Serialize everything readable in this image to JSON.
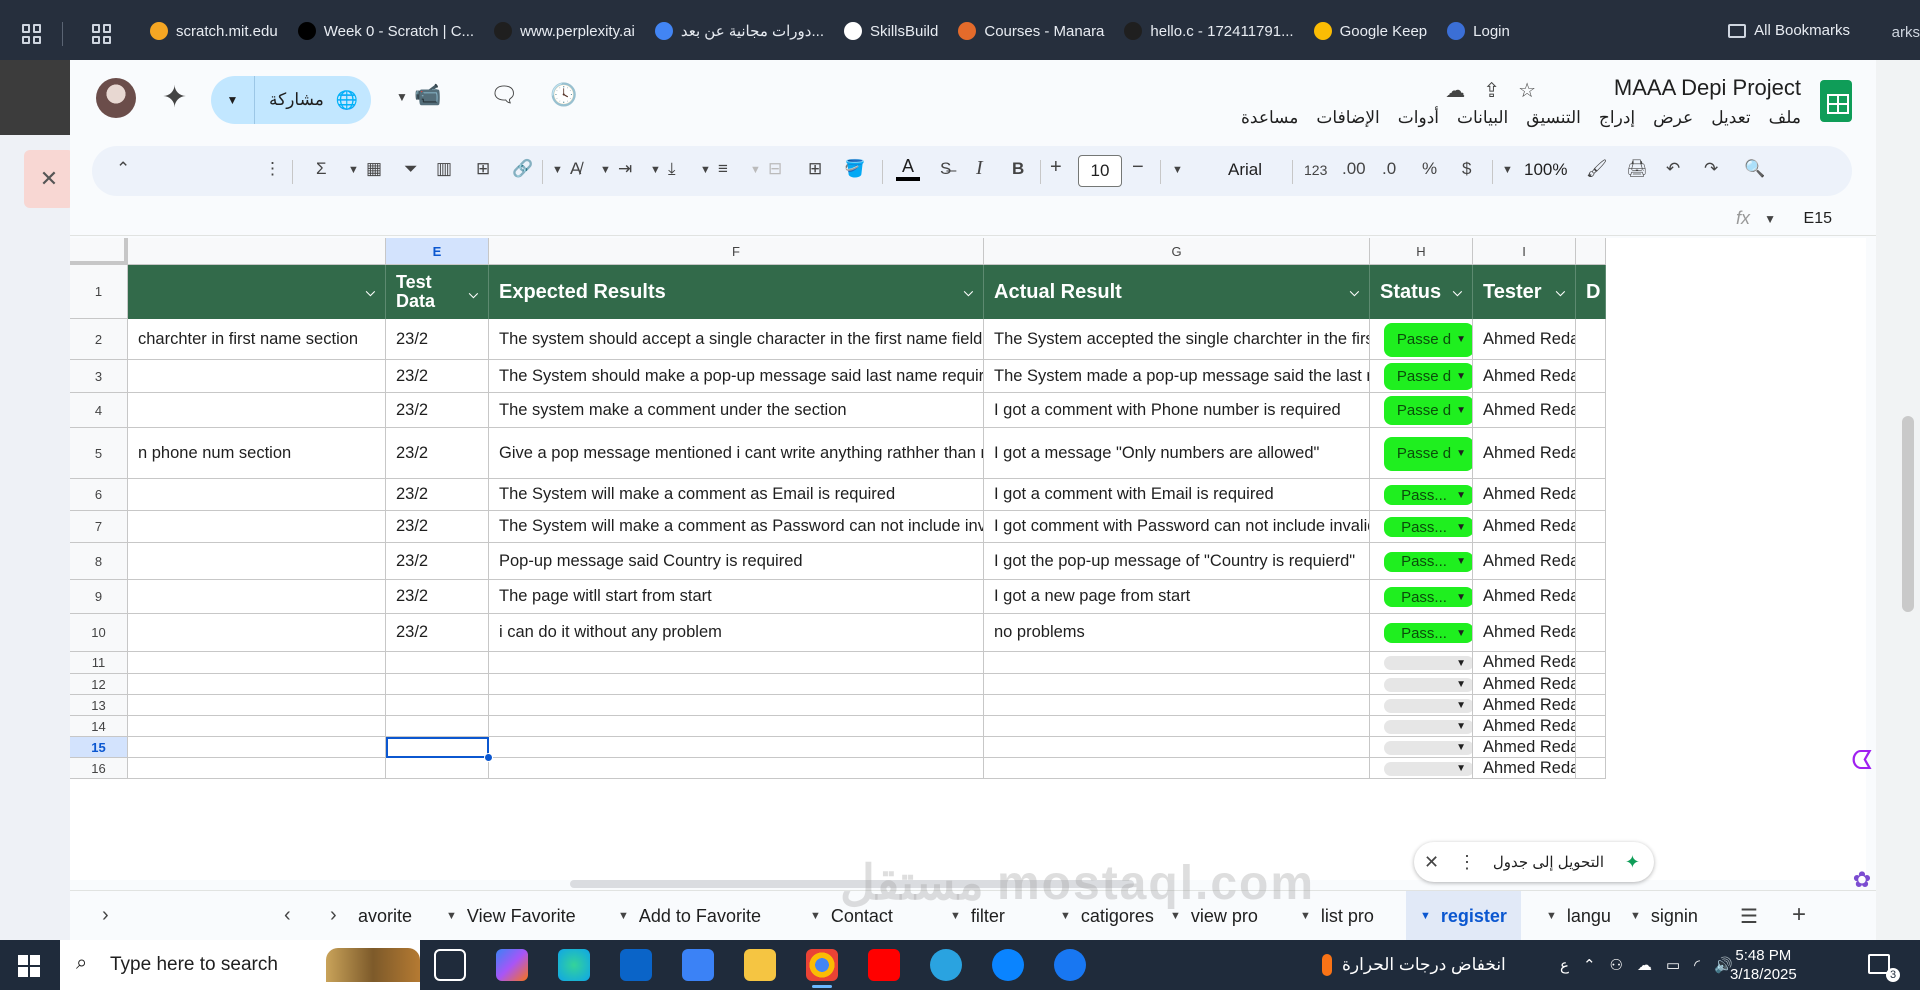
{
  "browser": {
    "bookmarks": [
      {
        "label": "scratch.mit.edu",
        "color": "#f5a623"
      },
      {
        "label": "Week 0 - Scratch | C...",
        "color": "#000000"
      },
      {
        "label": "www.perplexity.ai",
        "color": "#1f1f1f"
      },
      {
        "label": "دورات مجانية عن بعد...",
        "color": "#4285f4"
      },
      {
        "label": "SkillsBuild",
        "color": "#ffffff"
      },
      {
        "label": "Courses - Manara",
        "color": "#e46b2b"
      },
      {
        "label": "hello.c - 172411791...",
        "color": "#1f1f1f"
      },
      {
        "label": "Google Keep",
        "color": "#fbbc04"
      },
      {
        "label": "Login",
        "color": "#3b6fd6"
      }
    ],
    "all_bookmarks": "All Bookmarks",
    "more": "arks"
  },
  "sheets": {
    "title": "MAAA Depi Project",
    "menus": [
      "ملف",
      "تعديل",
      "عرض",
      "إدراج",
      "التنسيق",
      "البيانات",
      "أدوات",
      "الإضافات",
      "مساعدة"
    ],
    "share_label": "مشاركة",
    "toolbar": {
      "zoom": "100%",
      "font": "Arial",
      "font_size": "10",
      "currency": "$",
      "percent": "%",
      "number_format": "123"
    },
    "name_box": "E15",
    "fx": "fx",
    "columns": [
      {
        "letter": "",
        "header": ""
      },
      {
        "letter": "E",
        "header": "Test Data"
      },
      {
        "letter": "F",
        "header": "Expected Results"
      },
      {
        "letter": "G",
        "header": "Actual Result"
      },
      {
        "letter": "H",
        "header": "Status"
      },
      {
        "letter": "I",
        "header": "Tester"
      },
      {
        "letter": "",
        "header": "D"
      }
    ],
    "rows": [
      {
        "n": "2",
        "d": "charchter in first name section",
        "e": "23/2",
        "f": "The system should accept a single character in the first name field",
        "g": "The System accepted the single charchter in the first name",
        "status": "Passe d",
        "tester": "Ahmed Reda"
      },
      {
        "n": "3",
        "d": "",
        "e": "23/2",
        "f": "The System should make a pop-up message said last name required",
        "g": "The System made a pop-up message said the last name is req",
        "status": "Passe d",
        "tester": "Ahmed Reda"
      },
      {
        "n": "4",
        "d": "",
        "e": "23/2",
        "f": "The system make a comment under the section",
        "g": "I got a comment with Phone number is required",
        "status": "Passe d",
        "tester": "Ahmed Reda"
      },
      {
        "n": "5",
        "d": "n phone num section",
        "e": "23/2",
        "f": "Give a pop message mentioned i cant write anything rathher than numbers",
        "g": "I got a message \"Only numbers are allowed\"",
        "status": "Passe d",
        "tester": "Ahmed Reda"
      },
      {
        "n": "6",
        "d": "",
        "e": "23/2",
        "f": "The System will make a comment as Email is required",
        "g": "I got a comment with Email is required",
        "status": "Pass...",
        "tester": "Ahmed Reda"
      },
      {
        "n": "7",
        "d": "",
        "e": "23/2",
        "f": "The System will make a comment as Password can not include invalid characters",
        "g": "I got comment with Password can not include invalid character",
        "status": "Pass...",
        "tester": "Ahmed Reda"
      },
      {
        "n": "8",
        "d": "",
        "e": "23/2",
        "f": "Pop-up message said Country is required",
        "g": "I got the pop-up message of \"Country is requierd\"",
        "status": "Pass...",
        "tester": "Ahmed Reda"
      },
      {
        "n": "9",
        "d": "",
        "e": "23/2",
        "f": "The page witll start from start",
        "g": "I got a new page from start",
        "status": "Pass...",
        "tester": "Ahmed Reda"
      },
      {
        "n": "10",
        "d": "",
        "e": "23/2",
        "f": "i can do it without any problem",
        "g": "no problems",
        "status": "Pass...",
        "tester": "Ahmed Reda"
      },
      {
        "n": "11",
        "tester": "Ahmed Reda"
      },
      {
        "n": "12",
        "tester": "Ahmed Reda"
      },
      {
        "n": "13",
        "tester": "Ahmed Reda"
      },
      {
        "n": "14",
        "tester": "Ahmed Reda"
      },
      {
        "n": "15",
        "tester": "Ahmed Reda"
      },
      {
        "n": "16",
        "tester": "Ahmed Reda"
      }
    ],
    "convert_label": "التحويل إلى جدول",
    "tabs": [
      "avorite",
      "View Favorite",
      "Add to Favorite",
      "Contact",
      "filter",
      "catigores",
      "view pro",
      "list pro",
      "register",
      "langu",
      "signin"
    ],
    "active_tab": "register"
  },
  "taskbar": {
    "search_placeholder": "Type here to search",
    "weather": "انخفاض درجات الحرارة",
    "lang": "ع",
    "time": "5:48 PM",
    "date": "3/18/2025",
    "notifications": "3"
  },
  "watermark": "مستقل mostaql.com"
}
